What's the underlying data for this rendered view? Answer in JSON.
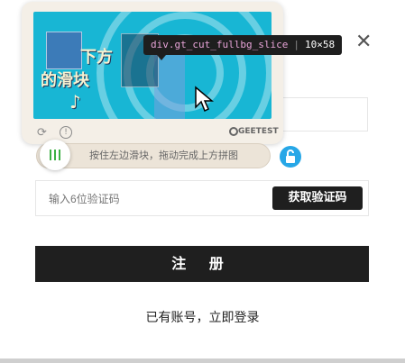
{
  "tooltip": {
    "selector": "div.gt_cut_fullbg_slice",
    "size": "10×58"
  },
  "captcha": {
    "image_text_line1": "下方",
    "image_text_line2": "的滑块",
    "brand": "GEETEST",
    "slider_hint": "按住左边滑块，拖动完成上方拼图"
  },
  "form": {
    "code_placeholder": "输入6位验证码",
    "get_code_label": "获取验证码",
    "submit_label": "注 册",
    "login_link": "已有账号，立即登录"
  },
  "colors": {
    "image_bg": "#18b6d4",
    "slider_accent": "#3cb043",
    "lock_blue": "#27a7e7",
    "button_dark": "#1f1f1f"
  },
  "icons": [
    "close-icon",
    "refresh-icon",
    "info-icon",
    "geetest-logo-icon",
    "slider-handle-icon",
    "lock-icon",
    "mouse-cursor-icon"
  ]
}
